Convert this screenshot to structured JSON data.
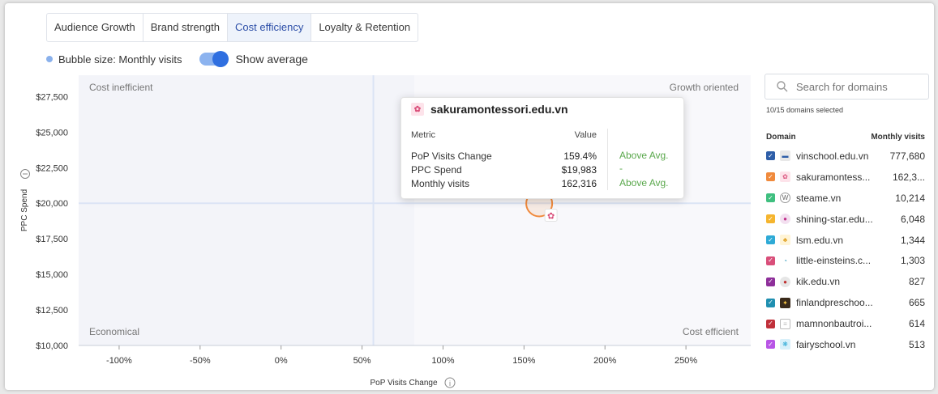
{
  "tabs": [
    {
      "label": "Audience Growth",
      "active": false
    },
    {
      "label": "Brand strength",
      "active": false
    },
    {
      "label": "Cost efficiency",
      "active": true
    },
    {
      "label": "Loyalty & Retention",
      "active": false
    }
  ],
  "legend": {
    "bubble_label": "Bubble size: Monthly visits",
    "toggle_label": "Show average",
    "toggle_on": true
  },
  "quadrants": {
    "top_left": "Cost inefficient",
    "top_right": "Growth oriented",
    "bottom_left": "Economical",
    "bottom_right": "Cost efficient"
  },
  "chart_data": {
    "type": "scatter",
    "xlabel": "PoP Visits Change",
    "ylabel": "PPC Spend",
    "x_ticks": [
      "-100%",
      "-50%",
      "0%",
      "50%",
      "100%",
      "150%",
      "200%",
      "250%"
    ],
    "y_ticks": [
      "$27,500",
      "$25,000",
      "$22,500",
      "$20,000",
      "$17,500",
      "$15,000",
      "$12,500",
      "$10,000"
    ],
    "xlim": [
      -125,
      290
    ],
    "ylim": [
      10000,
      29000
    ],
    "average": {
      "x": 57,
      "y": 20000
    },
    "points": [
      {
        "domain": "sakuramontessori.edu.vn",
        "x": 159.4,
        "y": 19983,
        "size": 162316,
        "color": "#f08a3c"
      }
    ]
  },
  "tooltip": {
    "domain": "sakuramontessori.edu.vn",
    "col_metric": "Metric",
    "col_value": "Value",
    "rows": [
      {
        "metric": "PoP Visits Change",
        "value": "159.4%",
        "flag": "Above Avg."
      },
      {
        "metric": "PPC Spend",
        "value": "$19,983",
        "flag": "-"
      },
      {
        "metric": "Monthly visits",
        "value": "162,316",
        "flag": "Above Avg."
      }
    ]
  },
  "search": {
    "placeholder": "Search for domains"
  },
  "selected_count": "10/15 domains selected",
  "domain_table": {
    "col_domain": "Domain",
    "col_visits": "Monthly visits",
    "rows": [
      {
        "name": "vinschool.edu.vn",
        "visits": "777,680",
        "color": "#2e5ea8",
        "icon": "vinschool-icon"
      },
      {
        "name": "sakuramontess...",
        "visits": "162,3...",
        "color": "#f08a3c",
        "icon": "sakura-icon"
      },
      {
        "name": "steame.vn",
        "visits": "10,214",
        "color": "#3fbf7f",
        "icon": "wordpress-icon"
      },
      {
        "name": "shining-star.edu...",
        "visits": "6,048",
        "color": "#f5b52e",
        "icon": "shining-star-icon"
      },
      {
        "name": "lsm.edu.vn",
        "visits": "1,344",
        "color": "#2eaad6",
        "icon": "lsm-icon"
      },
      {
        "name": "little-einsteins.c...",
        "visits": "1,303",
        "color": "#d94f7a",
        "icon": "little-einsteins-icon"
      },
      {
        "name": "kik.edu.vn",
        "visits": "827",
        "color": "#8e2f9a",
        "icon": "kik-icon"
      },
      {
        "name": "finlandpreschoo...",
        "visits": "665",
        "color": "#1f8fb0",
        "icon": "finland-icon"
      },
      {
        "name": "mamnonbautroi...",
        "visits": "614",
        "color": "#c0303a",
        "icon": "document-icon"
      },
      {
        "name": "fairyschool.vn",
        "visits": "513",
        "color": "#b955e6",
        "icon": "fairyschool-icon"
      }
    ]
  }
}
